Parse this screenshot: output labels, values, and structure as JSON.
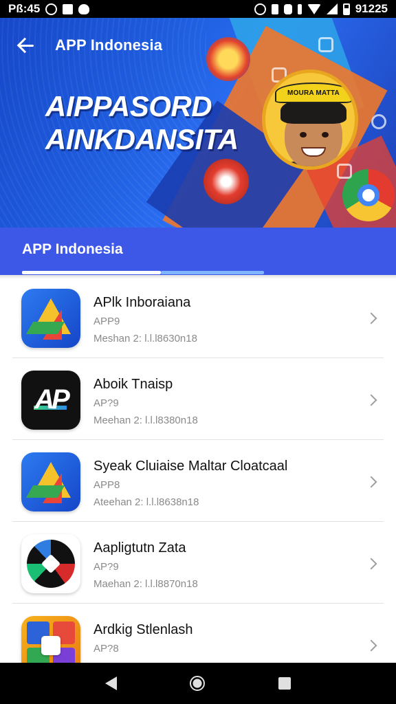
{
  "status_bar": {
    "time": "Pß:45",
    "battery_text": "91225",
    "icons": [
      "alarm-icon",
      "image-icon",
      "ghost-icon",
      "clock-icon",
      "vibrate-icon",
      "nfc-icon",
      "data-icon",
      "wifi-icon",
      "signal-icon",
      "battery-icon"
    ]
  },
  "header": {
    "title": "APP Indonesia",
    "hero_title_line1": "AIPPASORD",
    "hero_title_line2": "AINKDANSITA",
    "avatar_band_text": "MOURA MATTA"
  },
  "tabs": [
    {
      "label": "APP Indonesia",
      "selected": true
    }
  ],
  "apps": [
    {
      "name": "APlk Inboraiana",
      "category": "APP9",
      "meta": "Meshan  2: l.l.l8630n18",
      "icon": "google-drive-icon"
    },
    {
      "name": "Aboik Tnaisp",
      "category": "AP?9",
      "meta": "Meehan  2: l.l.l8380n18",
      "icon": "ap-logo-icon"
    },
    {
      "name": "Syeak Cluiaise Maltar Cloatcaal",
      "category": "APP8",
      "meta": "Ateehan  2: l.l.l8638n18",
      "icon": "google-drive-icon"
    },
    {
      "name": "Aapligtutn Zata",
      "category": "AP?9",
      "meta": "Maehan  2: l.l.l8870n18",
      "icon": "pinwheel-icon"
    },
    {
      "name": "Ardkig Stlenlash",
      "category": "AP?8",
      "meta": "",
      "icon": "game-icon"
    }
  ],
  "colors": {
    "accent": "#3d57e6",
    "hero_blue": "#1f5fe0",
    "tab_indicator": "#ffffff"
  }
}
